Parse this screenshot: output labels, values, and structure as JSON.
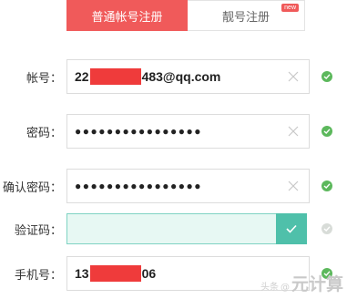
{
  "tabs": {
    "normal_label": "普通帐号注册",
    "premium_label": "靓号注册",
    "new_badge": "new"
  },
  "form": {
    "account": {
      "label": "帐号：",
      "value_prefix": "22",
      "value_suffix": "483@qq.com"
    },
    "password": {
      "label": "密码：",
      "value": "●●●●●●●●●●●●●●●●"
    },
    "confirm_password": {
      "label": "确认密码：",
      "value": "●●●●●●●●●●●●●●●●"
    },
    "captcha": {
      "label": "验证码："
    },
    "phone": {
      "label": "手机号：",
      "value_prefix": "13",
      "value_suffix": "06"
    }
  },
  "colors": {
    "accent": "#f05a5a",
    "success": "#5cb85c",
    "captcha_ok": "#4fc0aa"
  },
  "watermark": {
    "small": "头条",
    "at": "@",
    "brand": "元计算"
  }
}
